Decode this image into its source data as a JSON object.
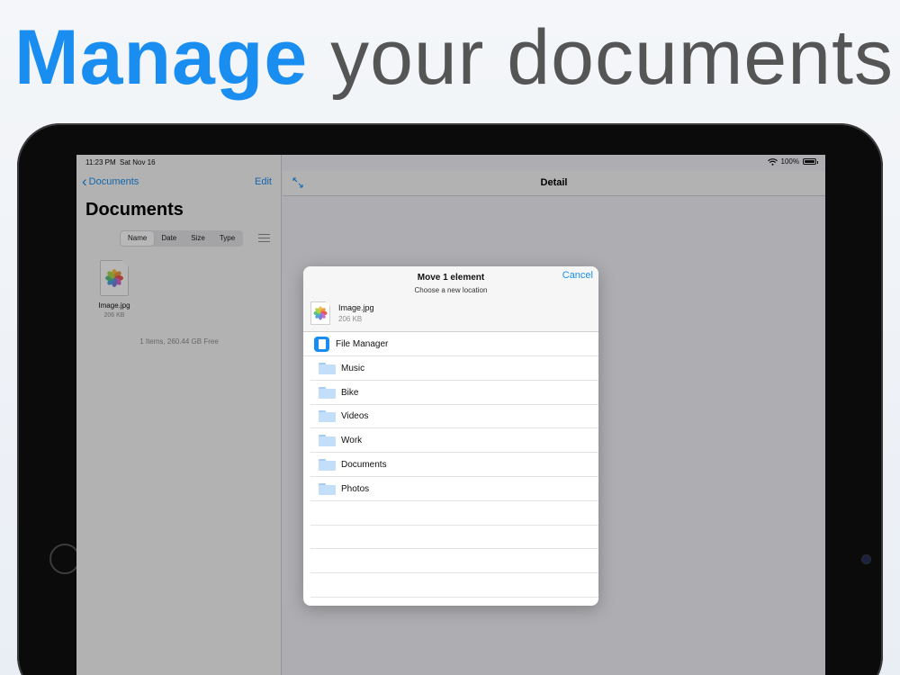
{
  "headline": {
    "strong": "Manage",
    "rest": " your documents"
  },
  "status_bar": {
    "time": "11:23 PM",
    "date": "Sat Nov 16",
    "battery": "100%"
  },
  "master": {
    "back_label": "Documents",
    "edit_label": "Edit",
    "title": "Documents",
    "sort_tabs": [
      {
        "label": "Name",
        "active": true
      },
      {
        "label": "Date",
        "active": false
      },
      {
        "label": "Size",
        "active": false
      },
      {
        "label": "Type",
        "active": false
      }
    ],
    "files": [
      {
        "name": "Image.jpg",
        "size": "206 KB",
        "icon": "photos-icon"
      }
    ],
    "storage_info": "1 Items, 260.44 GB Free"
  },
  "detail": {
    "title": "Detail"
  },
  "modal": {
    "title": "Move 1 element",
    "subtitle": "Choose a new location",
    "cancel_label": "Cancel",
    "file": {
      "name": "Image.jpg",
      "size": "206 KB"
    },
    "root": {
      "label": "File Manager",
      "icon": "file-manager-app-icon"
    },
    "folders": [
      {
        "label": "Music"
      },
      {
        "label": "Bike"
      },
      {
        "label": "Videos"
      },
      {
        "label": "Work"
      },
      {
        "label": "Documents"
      },
      {
        "label": "Photos"
      }
    ]
  },
  "colors": {
    "accent": "#1a8ef0",
    "headline_gray": "#555555",
    "folder": "#c3def8"
  }
}
